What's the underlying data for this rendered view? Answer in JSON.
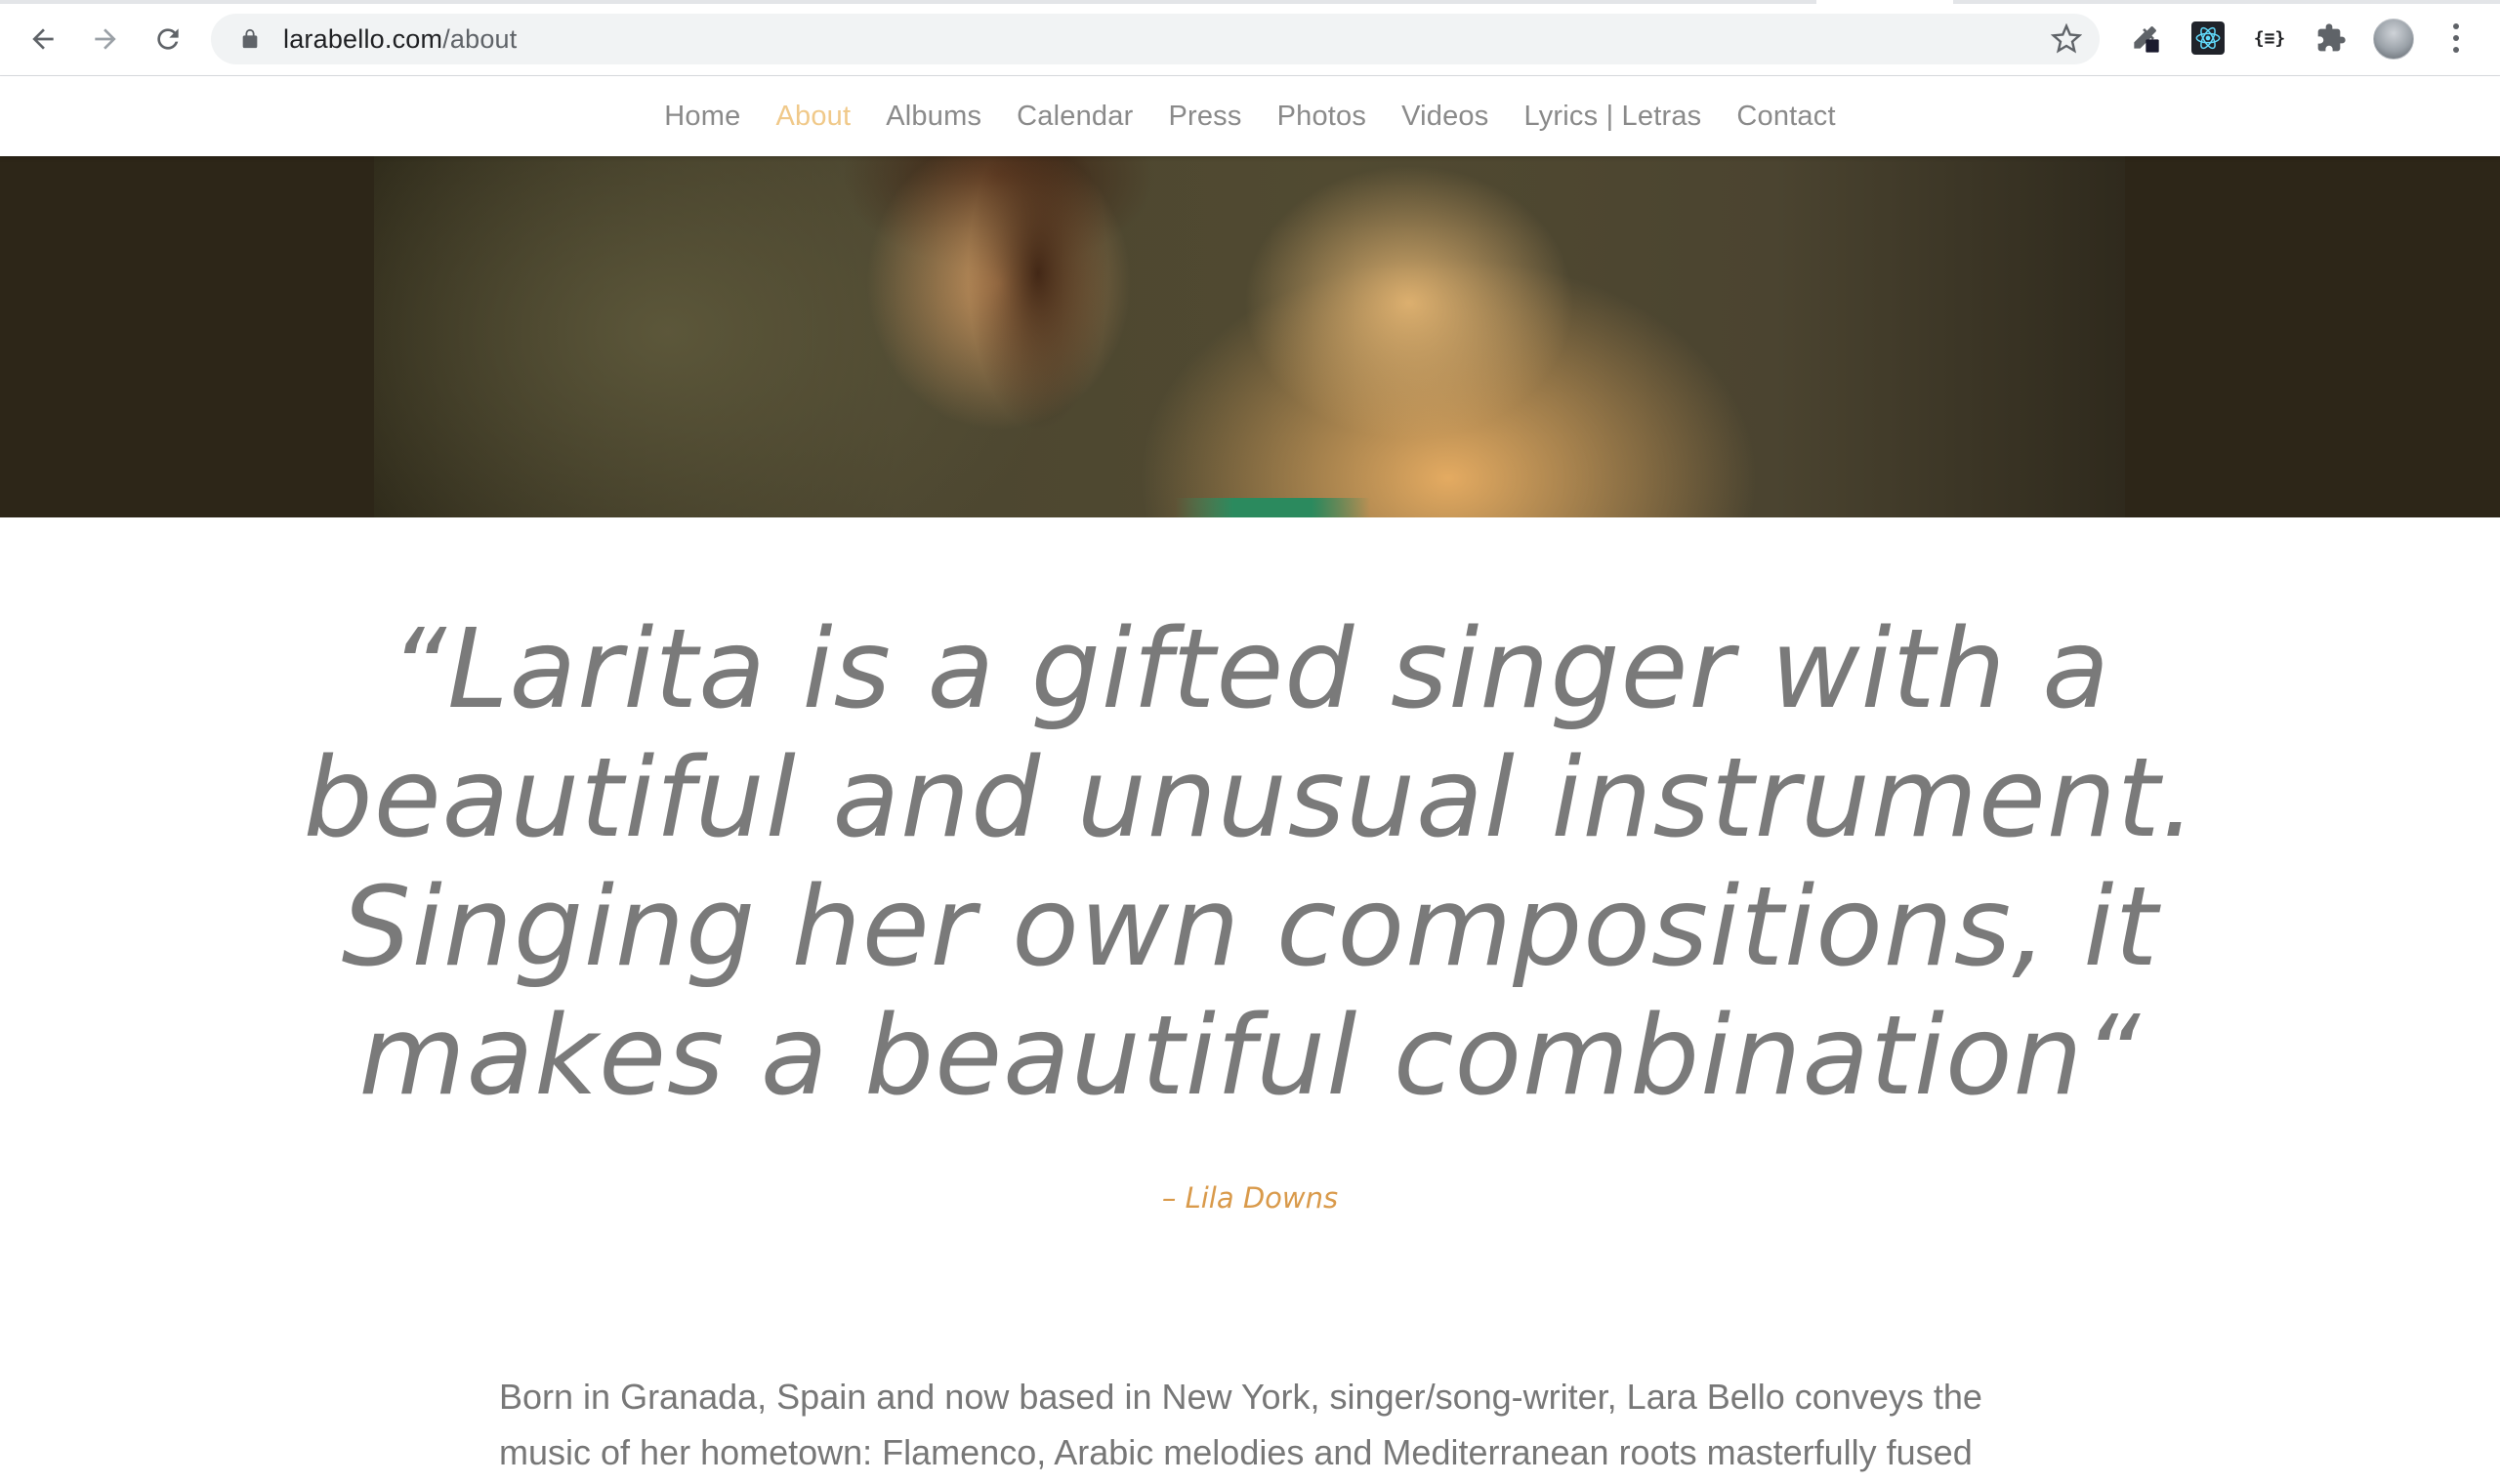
{
  "browser": {
    "url_host": "larabello.com",
    "url_path": "/about",
    "icons": {
      "back": "arrow-left-icon",
      "forward": "arrow-right-icon",
      "reload": "reload-icon",
      "lock": "lock-icon",
      "bookmark": "star-icon",
      "extensions": [
        "eyedropper-icon",
        "react-devtools-icon",
        "json-formatter-icon",
        "puzzle-icon"
      ],
      "menu": "kebab-menu-icon"
    }
  },
  "site_nav": {
    "items": [
      {
        "label": "Home"
      },
      {
        "label": "About",
        "active": true
      },
      {
        "label": "Albums"
      },
      {
        "label": "Calendar"
      },
      {
        "label": "Press"
      },
      {
        "label": "Photos"
      },
      {
        "label": "Videos"
      },
      {
        "label": "Lyrics | Letras"
      },
      {
        "label": "Contact"
      }
    ],
    "active_color": "#f0c98a",
    "text_color": "#8a8a8a"
  },
  "quote": {
    "text": "“Larita is a gifted singer with a beautiful and unusual instrument. Singing her own compositions, it makes a beautiful combination“",
    "attribution": "– Lila Downs",
    "attribution_color": "#d99a4b"
  },
  "bio": {
    "text": "Born in Granada, Spain and now based in New York, singer/song-writer, Lara Bello conveys the music of her hometown: Flamenco, Arabic melodies and Mediterranean roots masterfully fused"
  }
}
